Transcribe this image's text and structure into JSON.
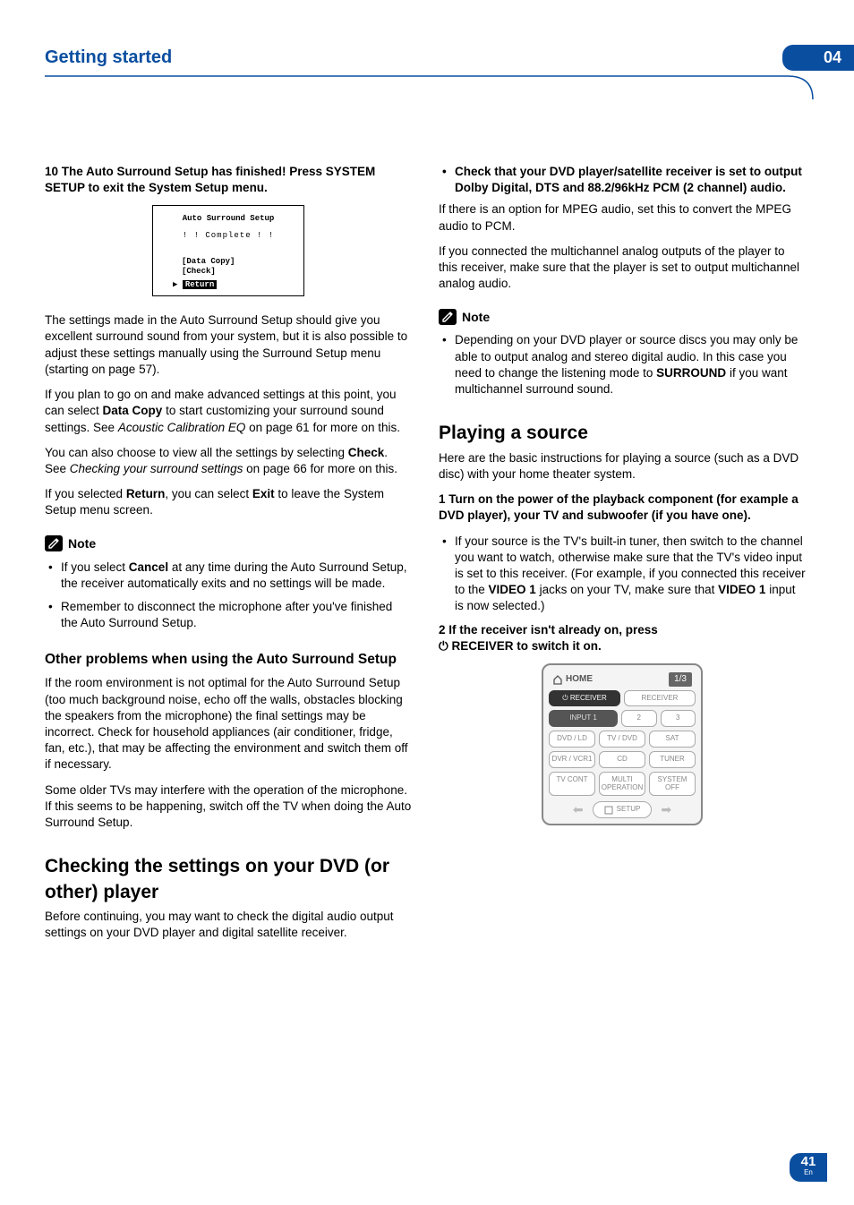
{
  "header": {
    "title": "Getting started",
    "chapter": "04"
  },
  "osd": {
    "title": "Auto Surround Setup",
    "complete": "! !  Complete  ! !",
    "opt1": "[Data Copy]",
    "opt2": "[Check]",
    "return_arrow": "▶",
    "return": "Return"
  },
  "left": {
    "step10": "10  The Auto Surround Setup has finished! Press SYSTEM SETUP to exit the System Setup menu.",
    "p1": "The settings made in the Auto Surround Setup should give you excellent surround sound from your system, but it is also possible to adjust these settings manually using the Surround Setup menu (starting on page 57).",
    "p2a": "If you plan to go on and make advanced settings at this point, you can select ",
    "p2b": "Data Copy",
    "p2c": " to start customizing your surround sound settings. See ",
    "p2d": "Acoustic Calibration EQ",
    "p2e": " on page 61 for more on this.",
    "p3a": "You can also choose to view all the settings by selecting ",
    "p3b": "Check",
    "p3c": ". See ",
    "p3d": "Checking your surround settings",
    "p3e": " on page 66 for more on this.",
    "p4a": "If you selected ",
    "p4b": "Return",
    "p4c": ", you can select ",
    "p4d": "Exit",
    "p4e": " to leave the System Setup menu screen.",
    "note_label": "Note",
    "note1a": "If you select ",
    "note1b": "Cancel",
    "note1c": " at any time during the Auto Surround Setup, the receiver automatically exits and no settings will be made.",
    "note2": "Remember to disconnect the microphone after you've finished the Auto Surround Setup.",
    "h3": "Other problems when using the Auto Surround Setup",
    "p5": "If the room environment is not optimal for the Auto Surround Setup (too much background noise, echo off the walls, obstacles blocking the speakers from the microphone) the final settings may be incorrect. Check for household appliances (air conditioner, fridge, fan, etc.), that may be affecting the environment and switch them off if necessary.",
    "p6": "Some older TVs may interfere with the operation of the microphone. If this seems to be happening, switch off the TV when doing the Auto Surround Setup.",
    "h2": "Checking the settings on your DVD (or other) player",
    "p7": "Before continuing, you may want to check the digital audio output settings on your DVD player and digital satellite receiver."
  },
  "right": {
    "b1": "Check that your DVD player/satellite receiver is set to output Dolby Digital, DTS and 88.2/96kHz PCM (2 channel) audio.",
    "p1": "If there is an option for MPEG audio, set this to convert the MPEG audio to PCM.",
    "p2": "If you connected the multichannel analog outputs of the player to this receiver, make sure that the player is set to output multichannel analog audio.",
    "note_label": "Note",
    "note1a": "Depending on your DVD player or source discs you may only be able to output analog and stereo digital audio. In this case you need to change the listening mode to ",
    "note1b": "SURROUND",
    "note1c": " if you want multichannel surround sound.",
    "h2": "Playing a source",
    "p3": "Here are the basic instructions for playing a source (such as a DVD disc) with your home theater system.",
    "step1": "1    Turn on the power of the playback component (for example a DVD player), your TV and subwoofer (if you have one).",
    "s1a": "If your source is the TV's built-in tuner, then switch to the channel you want to watch, otherwise make sure that the TV's video input is set to this receiver. (For example, if you connected this receiver to the ",
    "s1b": "VIDEO 1",
    "s1c": " jacks on your TV, make sure that ",
    "s1d": "VIDEO 1",
    "s1e": " input is now selected.)",
    "step2a": "2    If the receiver isn't already on, press",
    "step2b": " RECEIVER to switch it on."
  },
  "remote": {
    "home": "HOME",
    "page": "1/3",
    "recv_on": "RECEIVER",
    "recv_off": "RECEIVER",
    "input_label": "INPUT 1",
    "n2": "2",
    "n3": "3",
    "dvd": "DVD\n/ LD",
    "tv": "TV\n/ DVD",
    "sat": "SAT",
    "dvr": "DVR\n/ VCR1",
    "cd": "CD",
    "tuner": "TUNER",
    "tvcont": "TV\nCONT",
    "multi": "MULTI\nOPERATION",
    "sysoff": "SYSTEM\nOFF",
    "setup": "SETUP"
  },
  "footer": {
    "page": "41",
    "lang": "En"
  }
}
